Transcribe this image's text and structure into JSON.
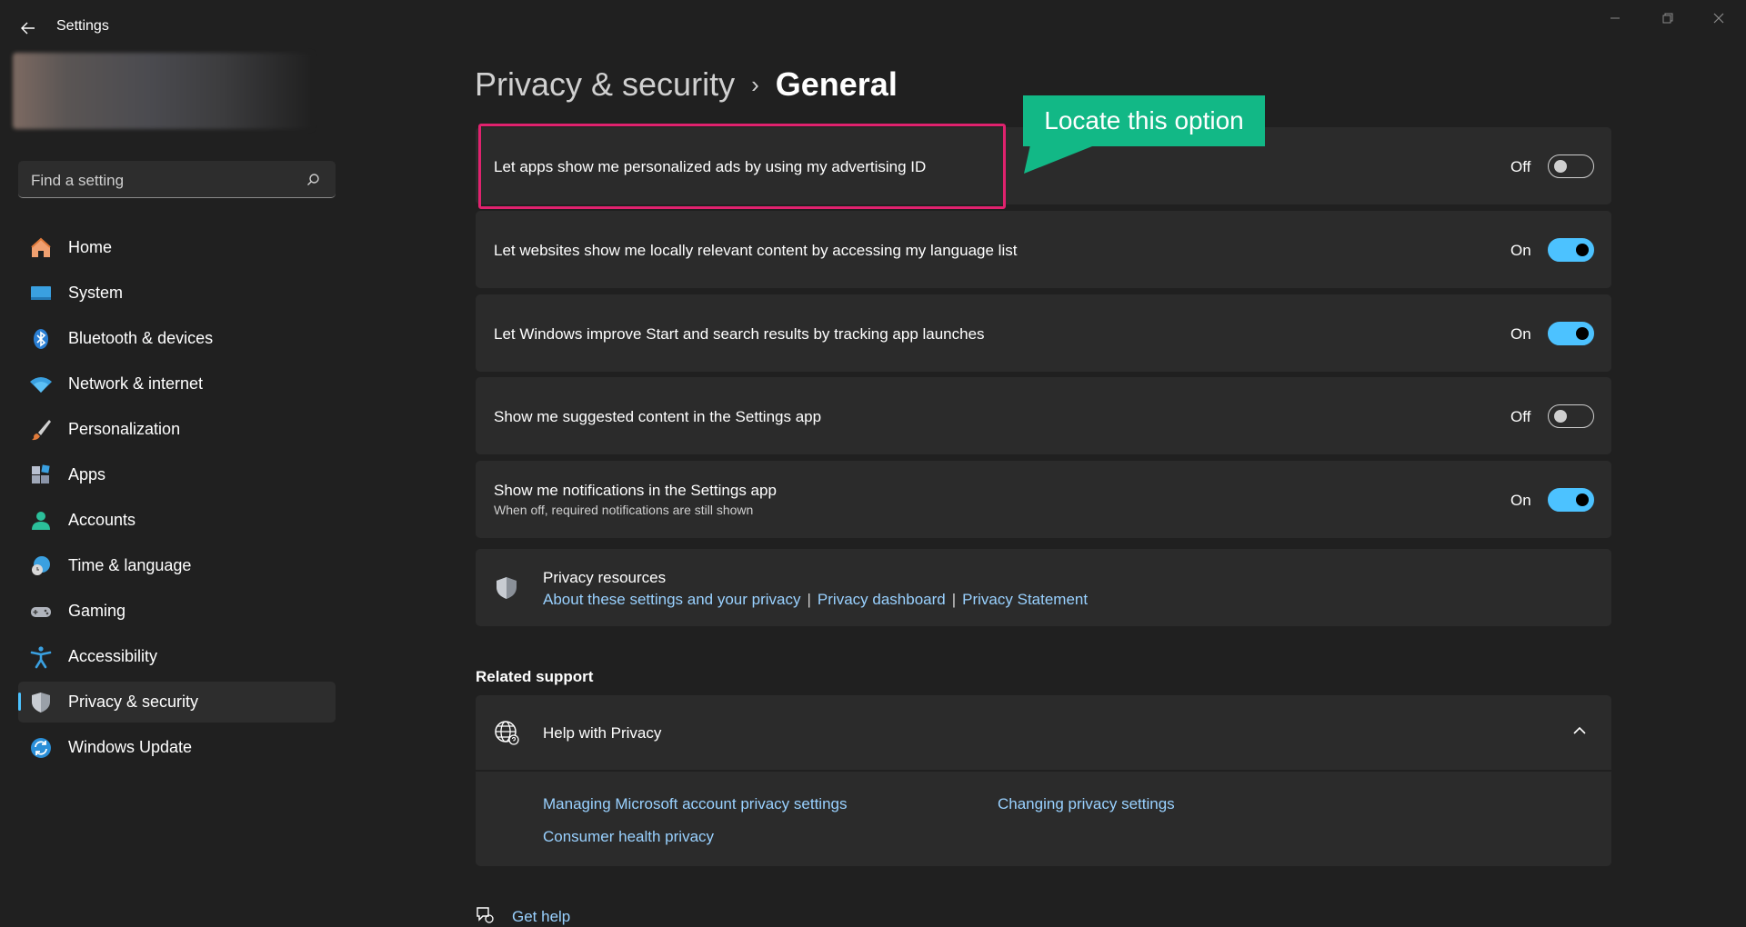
{
  "app": {
    "title": "Settings"
  },
  "search": {
    "placeholder": "Find a setting"
  },
  "sidebar": {
    "items": [
      {
        "label": "Home",
        "icon": "home-icon"
      },
      {
        "label": "System",
        "icon": "system-icon"
      },
      {
        "label": "Bluetooth & devices",
        "icon": "bluetooth-icon"
      },
      {
        "label": "Network & internet",
        "icon": "wifi-icon"
      },
      {
        "label": "Personalization",
        "icon": "brush-icon"
      },
      {
        "label": "Apps",
        "icon": "apps-icon"
      },
      {
        "label": "Accounts",
        "icon": "account-icon"
      },
      {
        "label": "Time & language",
        "icon": "globe-clock-icon"
      },
      {
        "label": "Gaming",
        "icon": "gamepad-icon"
      },
      {
        "label": "Accessibility",
        "icon": "accessibility-icon"
      },
      {
        "label": "Privacy & security",
        "icon": "shield-icon",
        "active": true
      },
      {
        "label": "Windows Update",
        "icon": "update-icon"
      }
    ]
  },
  "breadcrumb": {
    "parent": "Privacy & security",
    "separator": "›",
    "current": "General"
  },
  "settings": [
    {
      "label": "Let apps show me personalized ads by using my advertising ID",
      "state": "Off",
      "on": false
    },
    {
      "label": "Let websites show me locally relevant content by accessing my language list",
      "state": "On",
      "on": true
    },
    {
      "label": "Let Windows improve Start and search results by tracking app launches",
      "state": "On",
      "on": true
    },
    {
      "label": "Show me suggested content in the Settings app",
      "state": "Off",
      "on": false
    },
    {
      "label": "Show me notifications in the Settings app",
      "sub": "When off, required notifications are still shown",
      "state": "On",
      "on": true
    }
  ],
  "privacy_resources": {
    "title": "Privacy resources",
    "links": [
      "About these settings and your privacy",
      "Privacy dashboard",
      "Privacy Statement"
    ],
    "separator": "|"
  },
  "related_support": {
    "title": "Related support",
    "help": {
      "title": "Help with Privacy",
      "links": [
        "Managing Microsoft account privacy settings",
        "Changing privacy settings",
        "Consumer health privacy"
      ]
    }
  },
  "get_help": "Get help",
  "annotation": {
    "text": "Locate this option"
  },
  "colors": {
    "accent": "#4cc2ff",
    "highlight": "#e0226e",
    "callout": "#12b886",
    "link": "#99d1ff",
    "background": "#202020",
    "card": "#2b2b2b"
  }
}
